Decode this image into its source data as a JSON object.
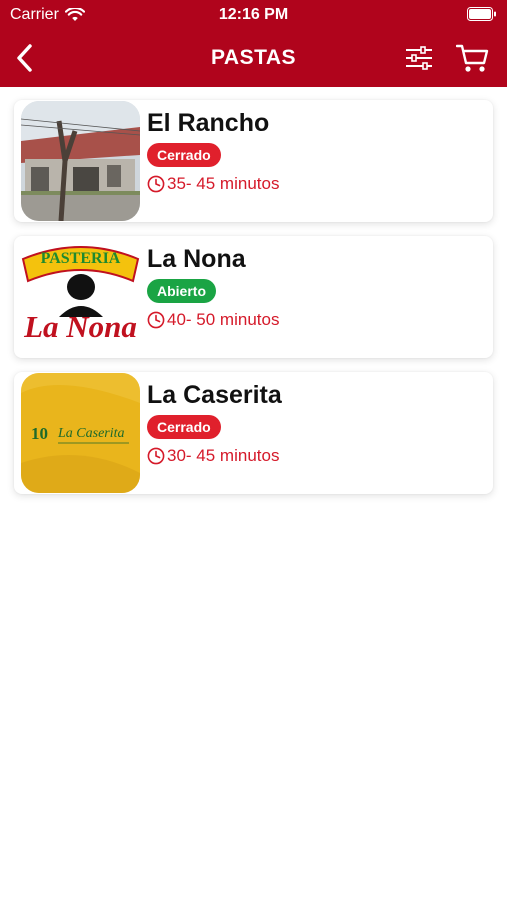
{
  "status_bar": {
    "carrier": "Carrier",
    "time": "12:16 PM"
  },
  "nav": {
    "title": "PASTAS",
    "back_icon": "chevron-left-icon",
    "filter_icon": "sliders-icon",
    "cart_icon": "cart-icon"
  },
  "colors": {
    "brand_red": "#b0041c",
    "closed": "#e0202c",
    "open": "#1aa444",
    "time_text": "#d51a2a"
  },
  "restaurants": [
    {
      "name": "El Rancho",
      "status": "Cerrado",
      "status_color": "#e0202c",
      "time": "35- 45 minutos"
    },
    {
      "name": "La Nona",
      "status": "Abierto",
      "status_color": "#1aa444",
      "time": "40- 50 minutos",
      "logo_text": {
        "top": "PASTERIA",
        "bottom": "La Nona"
      }
    },
    {
      "name": "La Caserita",
      "status": "Cerrado",
      "status_color": "#e0202c",
      "time": "30- 45 minutos",
      "logo_text": {
        "number": "10",
        "brand": "La Caserita"
      }
    }
  ]
}
